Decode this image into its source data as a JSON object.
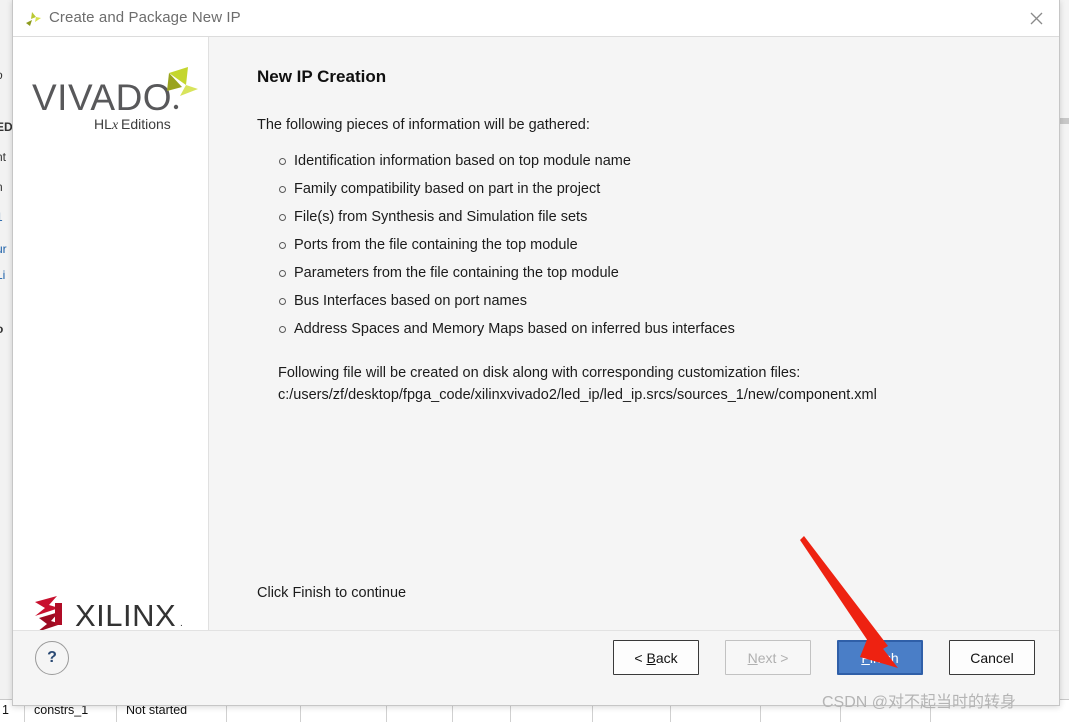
{
  "window": {
    "title": "Create and Package New IP",
    "icon": "vivado-pinwheel-icon",
    "close_icon": "close-icon"
  },
  "sidebar": {
    "product_name": "VIVADO",
    "product_edition": "HLx Editions",
    "vendor_name": "XILINX",
    "vendor_mark": "®"
  },
  "content": {
    "page_title": "New IP Creation",
    "intro": "The following pieces of information will be gathered:",
    "bullets": [
      "Identification information based on top module name",
      "Family compatibility based on part in the project",
      "File(s) from Synthesis and Simulation file sets",
      "Ports from the file containing the top module",
      "Parameters from the file containing the top module",
      "Bus Interfaces based on port names",
      "Address Spaces and Memory Maps based on inferred bus interfaces"
    ],
    "note_title": "Following file will be created on disk along with corresponding customization files:",
    "note_path": "c:/users/zf/desktop/fpga_code/xilinxvivado2/led_ip/led_ip.srcs/sources_1/new/component.xml",
    "finish_hint": "Click Finish to continue"
  },
  "footer": {
    "help_label": "?",
    "back_label": "< Back",
    "back_mnemonic": "B",
    "next_label": "Next >",
    "next_mnemonic": "N",
    "finish_label": "Finish",
    "finish_mnemonic": "F",
    "cancel_label": "Cancel"
  },
  "annotations": {
    "arrow": "red-arrow-pointing-to-finish",
    "watermark": "CSDN @对不起当时的转身"
  },
  "background": {
    "left_fragments": [
      "o",
      "ED",
      "nt",
      "n",
      "1",
      "ur",
      "Li",
      "o"
    ],
    "bottom_row": [
      "1",
      "constrs_1",
      "Not started"
    ]
  },
  "colors": {
    "accent_blue": "#4a7ec7",
    "accent_blue_border": "#2f5fa8",
    "xilinx_red": "#c8102e",
    "vivado_green": "#c4d62e",
    "annotation_red": "#ee2211",
    "panel_gray": "#f5f5f5",
    "help_blue": "#2b4a74"
  }
}
